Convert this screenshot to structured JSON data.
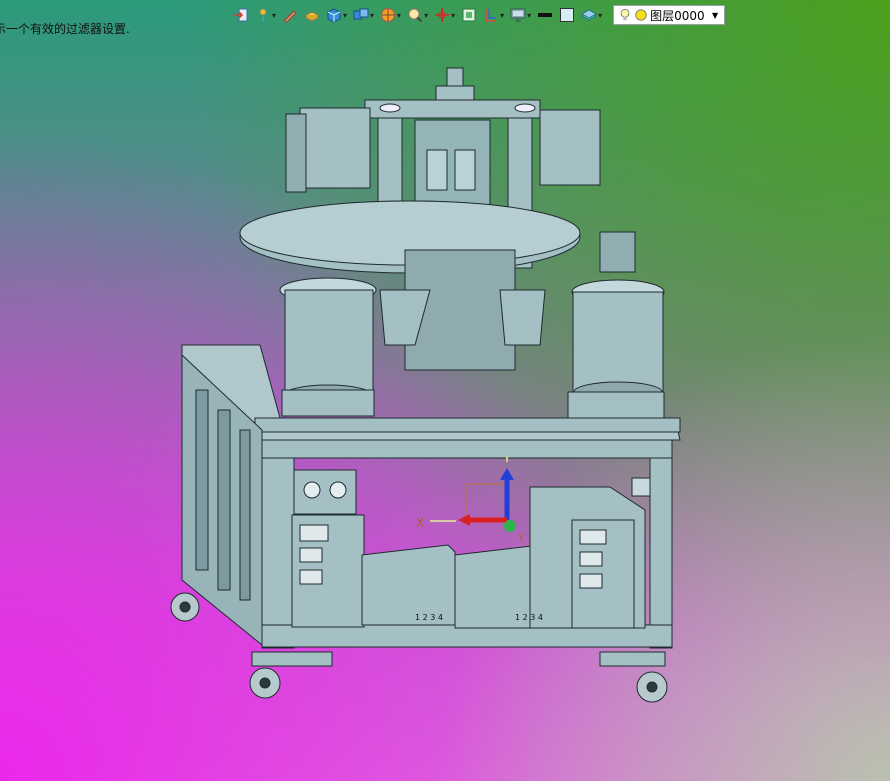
{
  "status": {
    "message": "示一个有效的过滤器设置."
  },
  "toolbar": {
    "buttons": [
      {
        "icon": "export-icon",
        "dropdown": false
      },
      {
        "icon": "pin-icon",
        "dropdown": true
      },
      {
        "icon": "pen-icon",
        "dropdown": false
      },
      {
        "icon": "block-icon",
        "dropdown": false
      },
      {
        "icon": "solid-cube-icon",
        "dropdown": true
      },
      {
        "icon": "multi-cube-icon",
        "dropdown": true
      },
      {
        "icon": "sphere-icon",
        "dropdown": true
      },
      {
        "icon": "zoom-icon",
        "dropdown": true
      },
      {
        "icon": "axis-icon",
        "dropdown": true
      },
      {
        "icon": "fit-icon",
        "dropdown": false
      },
      {
        "icon": "section-icon",
        "dropdown": true
      },
      {
        "icon": "display-icon",
        "dropdown": true
      },
      {
        "icon": "line-icon",
        "dropdown": false
      },
      {
        "icon": "square-icon",
        "dropdown": false
      },
      {
        "icon": "layer-stack-icon",
        "dropdown": true
      }
    ],
    "layer_label": "图层0000"
  },
  "viewport": {
    "axis_x_label": "X",
    "axis_y_label": "Y",
    "tag_left": "1 2 3 4",
    "tag_right": "1 2 3 4",
    "colors": {
      "machine": "#a4c0c4",
      "machine_dark": "#7c9aa0",
      "stroke": "#1e2a2e"
    }
  }
}
